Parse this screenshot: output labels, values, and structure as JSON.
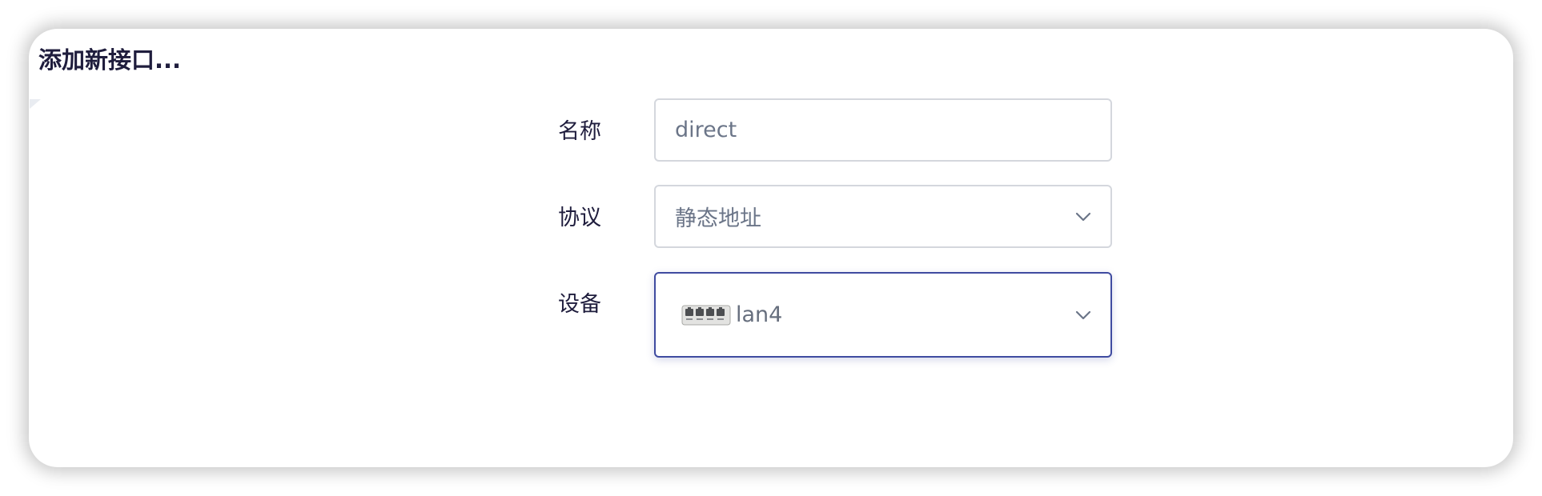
{
  "dialog": {
    "title": "添加新接口..."
  },
  "fields": {
    "name": {
      "label": "名称",
      "placeholder": "direct"
    },
    "protocol": {
      "label": "协议",
      "value": "静态地址"
    },
    "device": {
      "label": "设备",
      "value": "lan4",
      "icon": "ethernet-ports-icon"
    }
  },
  "colors": {
    "title": "#1f1d3d",
    "focus_border": "#3f4ba0",
    "input_border": "#d4d7dd",
    "placeholder": "#6b7588"
  }
}
